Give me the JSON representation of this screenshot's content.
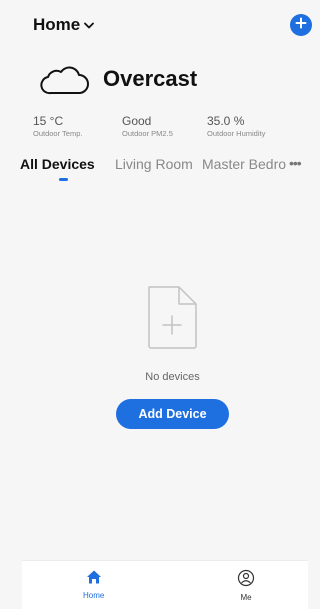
{
  "header": {
    "home_label": "Home",
    "home_chevron_icon": "chevron-down-icon",
    "add_icon": "plus-icon"
  },
  "weather": {
    "icon": "cloud-icon",
    "condition": "Overcast",
    "stats": [
      {
        "value": "15 °C",
        "label": "Outdoor Temp."
      },
      {
        "value": "Good",
        "label": "Outdoor PM2.5"
      },
      {
        "value": "35.0 %",
        "label": "Outdoor Humidity"
      }
    ]
  },
  "tabs": {
    "items": [
      {
        "label": "All Devices",
        "active": true
      },
      {
        "label": "Living Room",
        "active": false
      },
      {
        "label": "Master Bedroom",
        "active": false
      }
    ],
    "more_icon": "more-horizontal-icon"
  },
  "empty_state": {
    "icon": "empty-file-icon",
    "message": "No devices",
    "button_label": "Add Device"
  },
  "bottom_nav": {
    "items": [
      {
        "label": "Home",
        "icon": "home-icon",
        "active": true
      },
      {
        "label": "Me",
        "icon": "profile-icon",
        "active": false
      }
    ]
  },
  "colors": {
    "accent": "#1e6fe0",
    "background": "#f6f6f6"
  }
}
